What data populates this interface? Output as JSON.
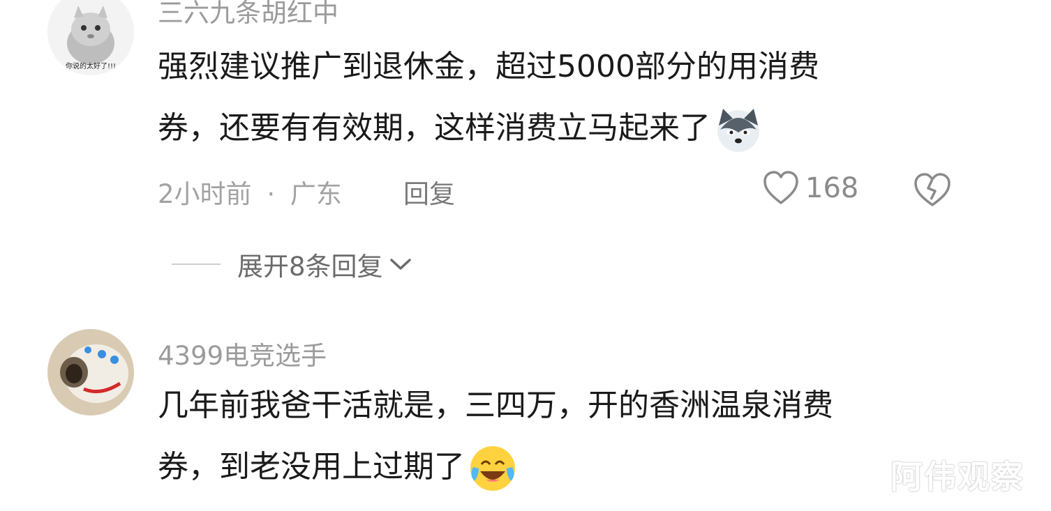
{
  "comments": [
    {
      "username": "三六九条胡红中",
      "avatar_caption": "你说的太好了!!!",
      "lines": [
        "强烈建议推广到退休金，超过5000部分的用消费",
        "券，还要有有效期，这样消费立马起来了"
      ],
      "line_emoji": "husky-emoji",
      "time": "2小时前",
      "separator": "·",
      "location": "广东",
      "reply_label": "回复",
      "like_count": "168",
      "expand_label": "展开8条回复"
    },
    {
      "username": "4399电竞选手",
      "lines": [
        "几年前我爸干活就是，三四万，开的香洲温泉消费",
        "券，到老没用上过期了"
      ],
      "line_emoji": "crying-laughing-emoji"
    }
  ],
  "watermark": "阿伟观察",
  "icons": [
    "heart-icon",
    "broken-heart-icon",
    "chevron-down-icon"
  ],
  "colors": {
    "text": "#1a1a1a",
    "meta": "#a2a2a2",
    "username": "#9b9b9b"
  }
}
